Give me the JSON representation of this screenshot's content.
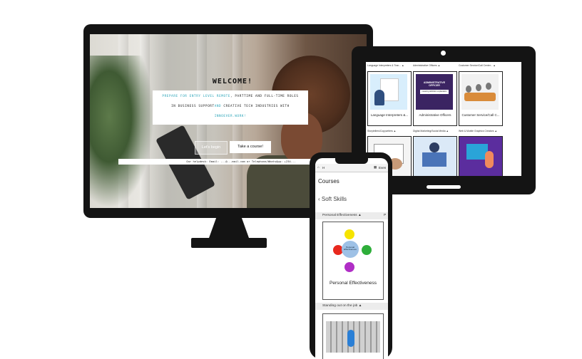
{
  "monitor": {
    "welcome": "WELCOME!",
    "hero": {
      "line1_teal": "PREPARE FOR ENTRY LEVEL REMOTE",
      "line1_rest": ", PARTTIME AND FULL-TIME ROLES",
      "line2_a": "IN BUSINESS SUPPORT",
      "line2_teal": "AND",
      "line2_b": " CREATIVE TECH INDUSTRIES WITH",
      "line3": "INNOEVER.WORK!"
    },
    "buttons": {
      "begin": "Let's begin",
      "course": "Take a course!"
    },
    "helpdesk": "Our helpdesk: Email: ...@...mail.com or Telephone/WhatsApp: +234..."
  },
  "laptop": {
    "headers": [
      "Language Interpreters & Tran... ▲",
      "Administrative Officers ▲",
      "Customer Service/Call Center... ▲"
    ],
    "cards": [
      "Language Interpreters &...",
      "Administrative Officers",
      "Customer Service/Call C..."
    ],
    "headers_row2": [
      "Storytellers/Copywriters ▲",
      "Digital Marketing/Social Media ▲",
      "Web & Mobile Graphics Creators ▲"
    ],
    "admin_image_title": "ADMINISTRATIVE OFFICER",
    "admin_image_sub": "meaning definition explanation"
  },
  "phone": {
    "nav_home": "H",
    "nav_events": "Even",
    "courses": "Courses",
    "soft_skills": "‹ Soft Skills",
    "section1": "Personal Effectiveness ▲",
    "section1_side": "P",
    "card1_title": "Personal Effectiveness",
    "card1_center": "Personal Effectiveness",
    "section2": "Standing out on the job ▲"
  },
  "colors": {
    "teal": "#2aa4b8",
    "device": "#141414"
  }
}
